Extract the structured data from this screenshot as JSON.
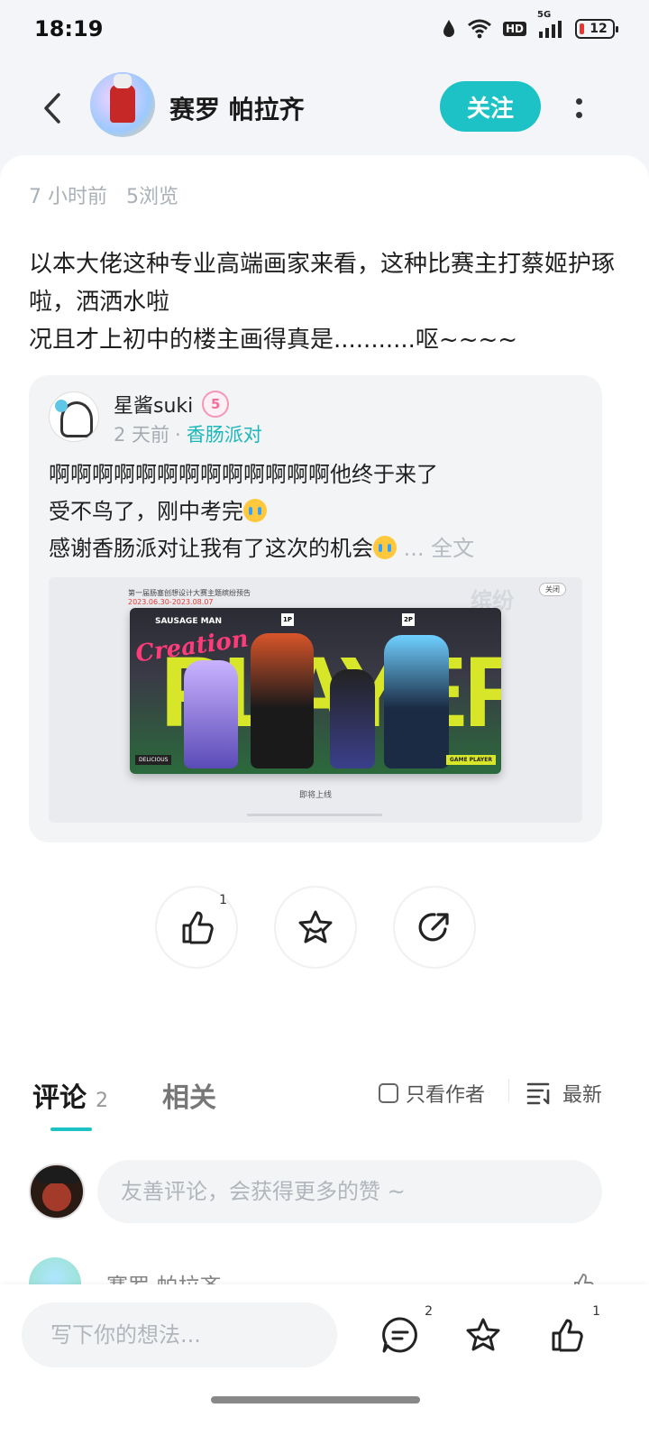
{
  "status_bar": {
    "time": "18:19",
    "hd": "HD",
    "network": "5G",
    "battery": "12"
  },
  "header": {
    "author_name": "赛罗 帕拉齐",
    "follow_label": "关注"
  },
  "post": {
    "time_ago": "7 小时前",
    "views": "5浏览",
    "text": "以本大佬这种专业高端画家来看，这种比赛主打蔡姬护琢啦，洒洒水啦\n况且才上初中的楼主画得真是...........呕~~~~"
  },
  "quoted_post": {
    "user_name": "星酱suki",
    "badge": "5",
    "time_ago": "2 天前",
    "separator": "·",
    "channel": "香肠派对",
    "line1": "啊啊啊啊啊啊啊啊啊啊啊啊啊他终于来了",
    "line2": "受不鸟了，刚中考完",
    "line3": "感谢香肠派对让我有了这次的机会",
    "more": "... 全文",
    "banner": {
      "top_title": "第一届肠塞创想设计大赛主题缤纷预告",
      "top_date": "2023.06.30-2023.08.07",
      "close": "关闭",
      "ghost_word": "缤纷",
      "brand": "SAUSAGE MAN",
      "creation": "Creation",
      "big_word": "PLAYER",
      "tag_1p": "1P",
      "tag_2p": "2P",
      "delicious": "DELICIOUS",
      "game_player": "GAME PLAYER",
      "bottom_text": "即将上线"
    }
  },
  "actions": {
    "like_count": "1"
  },
  "tabs": {
    "comments_label": "评论",
    "comments_count": "2",
    "related_label": "相关",
    "only_author": "只看作者",
    "sort": "最新"
  },
  "comment_box": {
    "placeholder": "友善评论，会获得更多的赞 ~"
  },
  "first_comment": {
    "user_name": "赛罗 帕拉齐"
  },
  "bottom_bar": {
    "placeholder": "写下你的想法...",
    "comment_count": "2",
    "like_count": "1"
  }
}
